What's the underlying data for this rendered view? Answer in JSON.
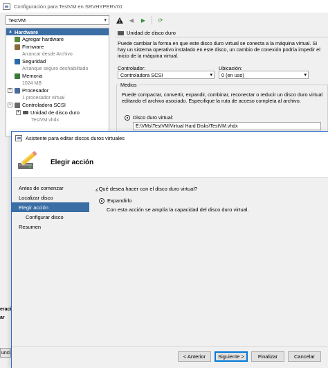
{
  "settings_window": {
    "title": "Configuración para TestVM en SRVHYPERV01",
    "vm_select": "TestVM",
    "tree": {
      "header": "Hardware",
      "items": [
        {
          "label": "Agregar hardware",
          "icon_color": "#5a8a3a"
        },
        {
          "label": "Firmware",
          "sub": "Arrancar desde Archivo",
          "icon_color": "#8a6a3a"
        },
        {
          "label": "Seguridad",
          "sub": "Arranque seguro deshabilitado",
          "icon_color": "#2a6aa8"
        },
        {
          "label": "Memoria",
          "sub": "1024 MB",
          "icon_color": "#3a7a3a"
        },
        {
          "label": "Procesador",
          "sub": "1 procesador virtual",
          "icon_color": "#4a6a9a"
        },
        {
          "label": "Controladora SCSI",
          "icon_color": "#6a6a6a"
        },
        {
          "label": "Unidad de disco duro",
          "sub": "TestVM.vhdx",
          "icon_color": "#555555"
        }
      ]
    },
    "details": {
      "section_title": "Unidad de disco duro",
      "description": "Puede cambiar la forma en que este disco duro virtual se conecta a la máquina virtual. Si hay un sistema operativo instalado en este disco, un cambio de conexión podría impedir el inicio de la máquina virtual.",
      "controller_label": "Controlador:",
      "controller_value": "Controladora SCSI",
      "location_label": "Ubicación:",
      "location_value": "0 (en uso)",
      "media_title": "Medios",
      "media_description": "Puede compactar, convertir, expandir, combinar, reconectar o reducir un disco duro virtual editando el archivo asociado. Especifique la ruta de acceso completa al archivo.",
      "vhd_radio_label": "Disco duro virtual:",
      "vhd_path": "E:\\VMs\\TestVM\\Virtual Hard Disks\\TestVM.vhdx"
    },
    "left_fragments": [
      "eraci",
      "ar",
      "uncio"
    ]
  },
  "wizard": {
    "title": "Asistente para editar discos duros virtuales",
    "heading": "Elegir acción",
    "steps": [
      {
        "label": "Antes de comenzar",
        "active": false,
        "sub": false
      },
      {
        "label": "Localizar disco",
        "active": false,
        "sub": false
      },
      {
        "label": "Elegir acción",
        "active": true,
        "sub": false
      },
      {
        "label": "Configurar disco",
        "active": false,
        "sub": true
      },
      {
        "label": "Resumen",
        "active": false,
        "sub": false
      }
    ],
    "question": "¿Qué desea hacer con el disco duro virtual?",
    "option_label": "Expandirlo",
    "option_selected": true,
    "option_description": "Con esta acción se amplía la capacidad del disco duro virtual.",
    "buttons": {
      "previous": "< Anterior",
      "next": "Siguiente >",
      "finish": "Finalizar",
      "cancel": "Cancelar"
    },
    "accent_color": "#3a6ea5"
  }
}
